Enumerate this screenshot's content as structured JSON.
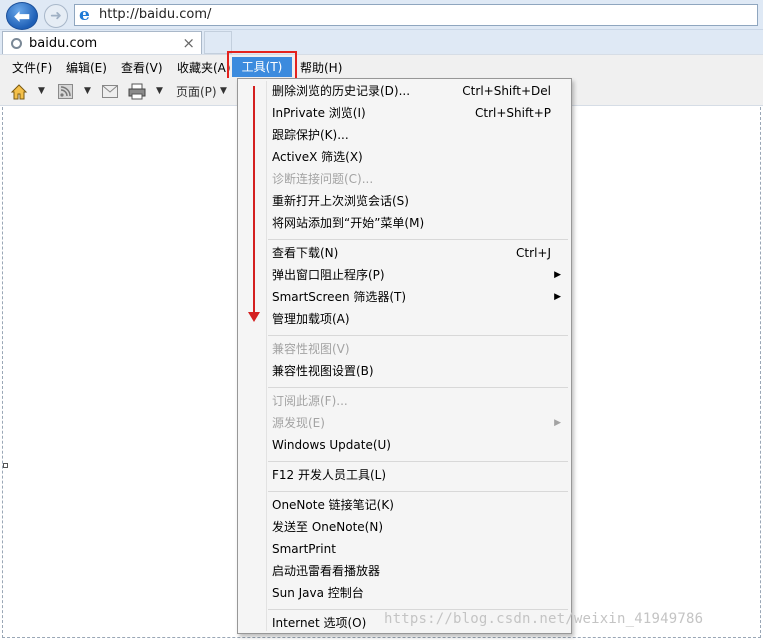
{
  "browser": {
    "url": "http://baidu.com/",
    "tab_title": "baidu.com",
    "tab_close": "×"
  },
  "menubar": {
    "items": [
      {
        "label": "文件(F)"
      },
      {
        "label": "编辑(E)"
      },
      {
        "label": "查看(V)"
      },
      {
        "label": "收藏夹(A)"
      },
      {
        "label": "工具(T)"
      },
      {
        "label": "帮助(H)"
      }
    ]
  },
  "commandbar": {
    "page_label": "页面(P)"
  },
  "tools_menu": {
    "items": [
      {
        "label": "删除浏览的历史记录(D)...",
        "shortcut": "Ctrl+Shift+Del",
        "enabled": true
      },
      {
        "label": "InPrivate 浏览(I)",
        "shortcut": "Ctrl+Shift+P",
        "enabled": true
      },
      {
        "label": "跟踪保护(K)...",
        "enabled": true
      },
      {
        "label": "ActiveX 筛选(X)",
        "enabled": true
      },
      {
        "label": "诊断连接问题(C)...",
        "enabled": false
      },
      {
        "label": "重新打开上次浏览会话(S)",
        "enabled": true
      },
      {
        "label": "将网站添加到“开始”菜单(M)",
        "enabled": true
      },
      {
        "label": "查看下载(N)",
        "shortcut": "Ctrl+J",
        "enabled": true
      },
      {
        "label": "弹出窗口阻止程序(P)",
        "submenu": true,
        "enabled": true
      },
      {
        "label": "SmartScreen 筛选器(T)",
        "submenu": true,
        "enabled": true
      },
      {
        "label": "管理加载项(A)",
        "enabled": true
      },
      {
        "label": "兼容性视图(V)",
        "enabled": false
      },
      {
        "label": "兼容性视图设置(B)",
        "enabled": true
      },
      {
        "label": "订阅此源(F)...",
        "enabled": false
      },
      {
        "label": "源发现(E)",
        "submenu": true,
        "enabled": false
      },
      {
        "label": "Windows Update(U)",
        "enabled": true
      },
      {
        "label": "F12 开发人员工具(L)",
        "enabled": true
      },
      {
        "label": "OneNote 链接笔记(K)",
        "enabled": true
      },
      {
        "label": "发送至 OneNote(N)",
        "enabled": true
      },
      {
        "label": "SmartPrint",
        "enabled": true
      },
      {
        "label": "启动迅雷看看播放器",
        "enabled": true
      },
      {
        "label": "Sun Java 控制台",
        "enabled": true
      },
      {
        "label": "Internet 选项(O)",
        "enabled": true
      }
    ],
    "submenu_arrow": "▶"
  },
  "watermark": "https://blog.csdn.net/weixin_41949786",
  "colors": {
    "menu_highlight": "#3c8bde",
    "annotation_red": "#e4231e"
  }
}
